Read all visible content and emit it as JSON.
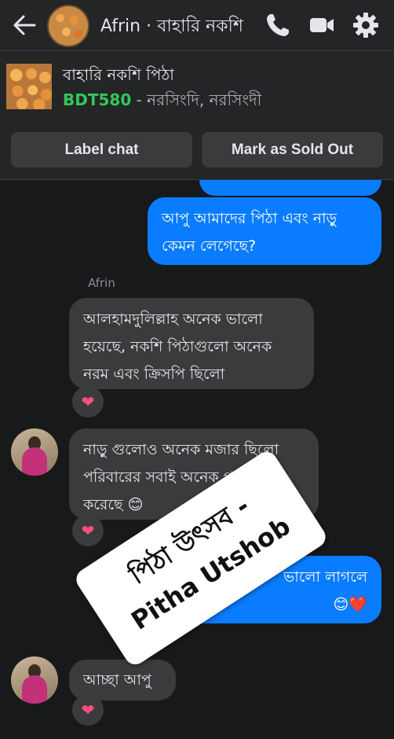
{
  "header": {
    "title": "Afrin · বাহারি নকশি",
    "icons": [
      "back-arrow-icon",
      "phone-icon",
      "video-icon",
      "gear-icon"
    ]
  },
  "product": {
    "name": "বাহারি নকশি পিঠা",
    "price": "BDT580",
    "location": " - নরসিংদি, নরসিংদী"
  },
  "actions": {
    "label_chat": "Label chat",
    "mark_sold": "Mark as Sold Out"
  },
  "messages": {
    "m1_line1": "আপু আমাদের পিঠা এবং নাড়ু",
    "m1_line2": "কেমন লেগেছে?",
    "sender_name": "Afrin",
    "m2_line1": "আলহামদুলিল্লাহ অনেক ভালো",
    "m2_line2": "হয়েছে, নকশি পিঠাগুলো অনেক",
    "m2_line3": "নরম এবং ক্রিসপি ছিলো",
    "m3_line1": "নাড়ু গুলোও অনেক মজার ছিলো",
    "m3_line2": "পরিবারের সবাই অনেক পছন্দ",
    "m3_line3": "করেছে 😊",
    "m4_line1": "ভালো লাগলে",
    "m4_line2": "😊❤️",
    "m5": "আচ্ছা আপু",
    "reaction": "❤"
  },
  "sticker": {
    "line1": "পিঠা উৎসব -",
    "line2": "Pitha Utshob"
  },
  "colors": {
    "accent": "#0a7cff",
    "price_green": "#34c759",
    "bg": "#18191a"
  }
}
